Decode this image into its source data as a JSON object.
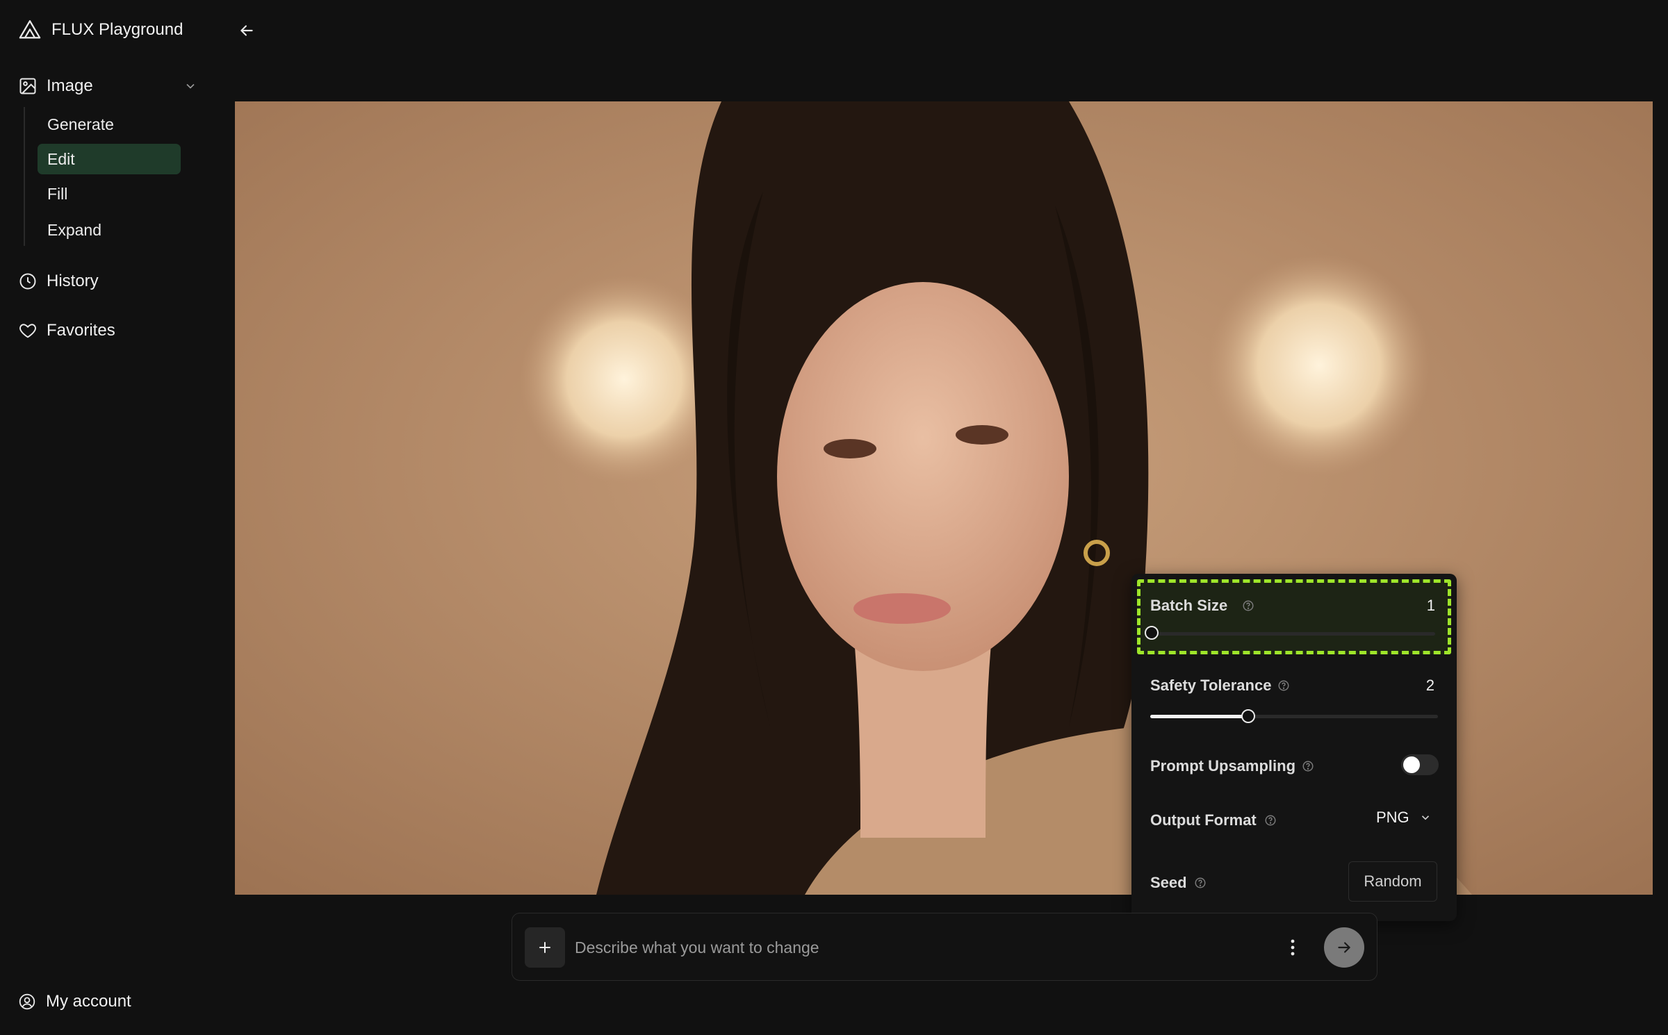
{
  "app": {
    "title": "FLUX Playground"
  },
  "sidebar": {
    "group": {
      "label": "Image",
      "icon": "image-icon"
    },
    "sub_items": [
      {
        "label": "Generate",
        "active": false
      },
      {
        "label": "Edit",
        "active": true
      },
      {
        "label": "Fill",
        "active": false
      },
      {
        "label": "Expand",
        "active": false
      }
    ],
    "history": {
      "label": "History",
      "icon": "clock-icon"
    },
    "favorites": {
      "label": "Favorites",
      "icon": "heart-icon"
    },
    "account": {
      "label": "My account",
      "icon": "user-circle-icon"
    }
  },
  "settings": {
    "batch_size": {
      "label": "Batch Size",
      "value": "1",
      "level": 0.0
    },
    "safety_tolerance": {
      "label": "Safety Tolerance",
      "value": "2",
      "level": 0.33
    },
    "prompt_upsampling": {
      "label": "Prompt Upsampling",
      "enabled": false
    },
    "output_format": {
      "label": "Output Format",
      "value": "PNG"
    },
    "seed": {
      "label": "Seed",
      "button_label": "Random"
    }
  },
  "prompt": {
    "placeholder": "Describe what you want to change",
    "value": ""
  },
  "colors": {
    "background": "#111111",
    "active_nav": "#1f3b2a",
    "highlight_border": "#9ee52a"
  }
}
